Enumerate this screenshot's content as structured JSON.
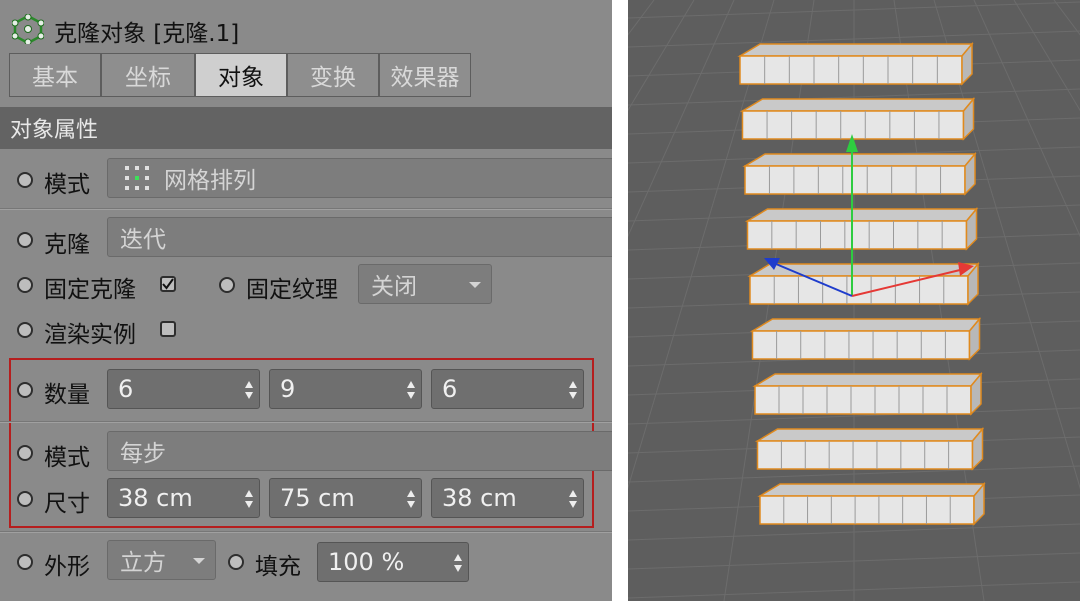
{
  "panel": {
    "title": "克隆对象 [克隆.1]",
    "tabs": [
      {
        "label": "基本",
        "active": false
      },
      {
        "label": "坐标",
        "active": false
      },
      {
        "label": "对象",
        "active": true
      },
      {
        "label": "变换",
        "active": false
      },
      {
        "label": "效果器",
        "active": false
      }
    ],
    "section_title": "对象属性",
    "mode": {
      "label": "模式",
      "value": "网格排列"
    },
    "clone": {
      "label": "克隆",
      "value": "迭代"
    },
    "fixed_clone": {
      "label": "固定克隆",
      "checked": true
    },
    "fixed_texture": {
      "label": "固定纹理",
      "value": "关闭"
    },
    "render_instances": {
      "label": "渲染实例",
      "checked": false
    },
    "count": {
      "label": "数量",
      "values": [
        "6",
        "9",
        "6"
      ]
    },
    "step_mode": {
      "label": "模式",
      "value": "每步"
    },
    "size": {
      "label": "尺寸",
      "values": [
        "38 cm",
        "75 cm",
        "38 cm"
      ]
    },
    "shape": {
      "label": "外形",
      "value": "立方"
    },
    "fill": {
      "label": "填充",
      "value": "100 %"
    }
  },
  "viewport": {
    "description_colors": {
      "background": "#5e5e5e",
      "selection": "#e08a1e",
      "axis_y": "#2ecc40",
      "axis_x": "#e53935",
      "axis_z": "#1e3ccc"
    },
    "layers": 9
  }
}
